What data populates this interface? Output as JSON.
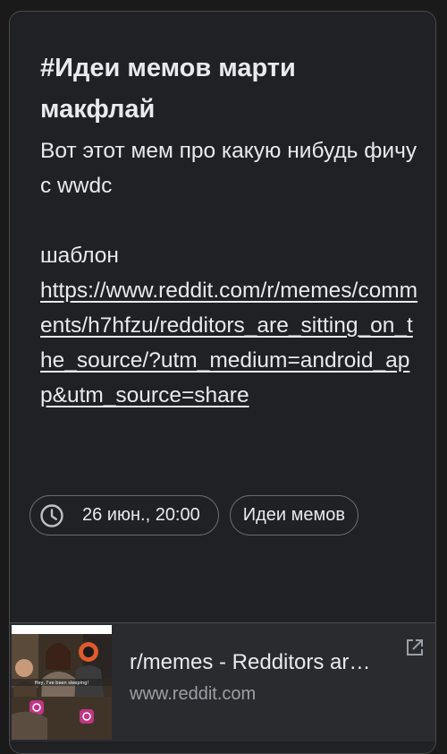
{
  "note": {
    "title": "#Идеи мемов марти макфлай",
    "body_line1": "Вот этот мем про какую нибудь фичу с wwdc",
    "body_line2": "шаблон",
    "link": "https://www.reddit.com/r/memes/comments/h7hfzu/redditors_are_sitting_on_the_source/?utm_medium=android_app&utm_source=share"
  },
  "chips": {
    "reminder": "26 июн., 20:00",
    "label": "Идеи мемов"
  },
  "link_preview": {
    "title": "r/memes - Redditors are sitting on the source",
    "domain": "www.reddit.com",
    "thumb_caption": "Hey, I've been sleeping!"
  },
  "icons": {
    "reminder": "clock-icon",
    "open": "open-external-icon",
    "thumbnail": "meme-thumbnail"
  },
  "colors": {
    "background": "#1a1a1b",
    "card": "#202124",
    "text": "#e8eaed",
    "muted": "#9aa0a6",
    "border": "#4a4a4d"
  }
}
